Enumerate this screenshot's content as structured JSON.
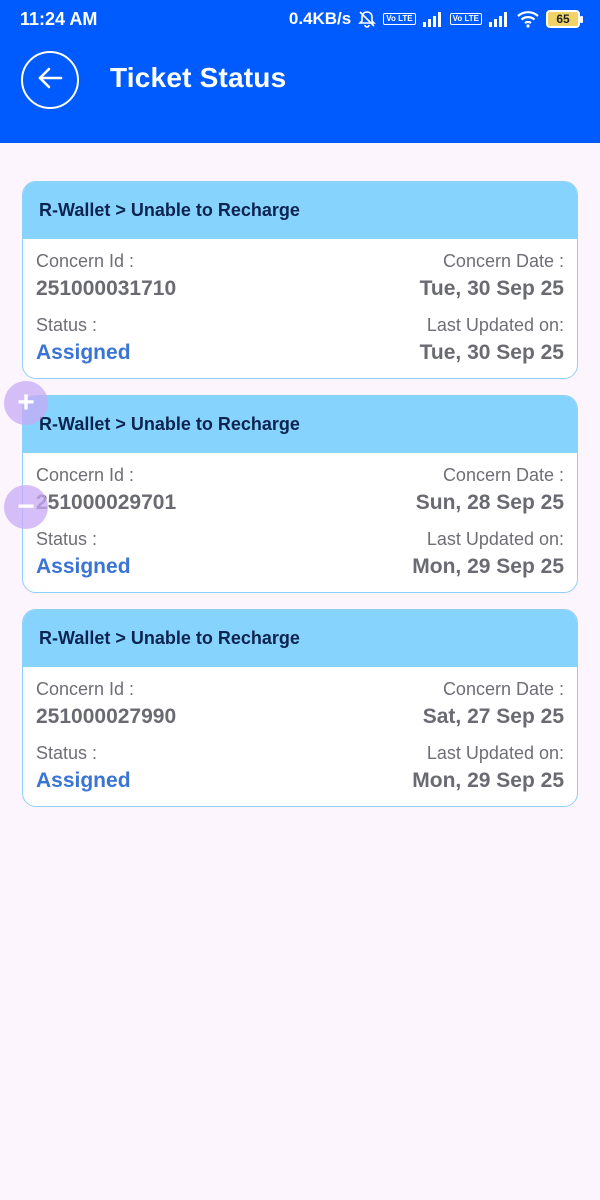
{
  "statusbar": {
    "time": "11:24 AM",
    "net_speed": "0.4KB/s",
    "volte": "Vo LTE",
    "battery": "65",
    "icons": [
      "mute-bell-icon",
      "volte-icon",
      "signal-icon",
      "volte-icon",
      "signal-icon",
      "wifi-icon",
      "battery-icon"
    ]
  },
  "header": {
    "title": "Ticket Status",
    "back_icon": "arrow-left-icon",
    "background": "#005bff"
  },
  "labels": {
    "concern_id": "Concern Id :",
    "concern_date": "Concern Date :",
    "status": "Status :",
    "last_updated": "Last Updated on:"
  },
  "tickets": [
    {
      "category": "R-Wallet > Unable to Recharge",
      "concern_id": "251000031710",
      "concern_date": "Tue, 30 Sep 25",
      "status": "Assigned",
      "last_updated": "Tue, 30 Sep 25"
    },
    {
      "category": "R-Wallet > Unable to Recharge",
      "concern_id": "251000029701",
      "concern_date": "Sun, 28 Sep 25",
      "status": "Assigned",
      "last_updated": "Mon, 29 Sep 25"
    },
    {
      "category": "R-Wallet > Unable to Recharge",
      "concern_id": "251000027990",
      "concern_date": "Sat, 27 Sep 25",
      "status": "Assigned",
      "last_updated": "Mon, 29 Sep 25"
    }
  ],
  "overlay": {
    "zoom_in": "+",
    "zoom_out": "−"
  },
  "colors": {
    "card_header": "#86d3fd",
    "status_text": "#3a74d4",
    "page_bg": "#fcf5fd"
  }
}
